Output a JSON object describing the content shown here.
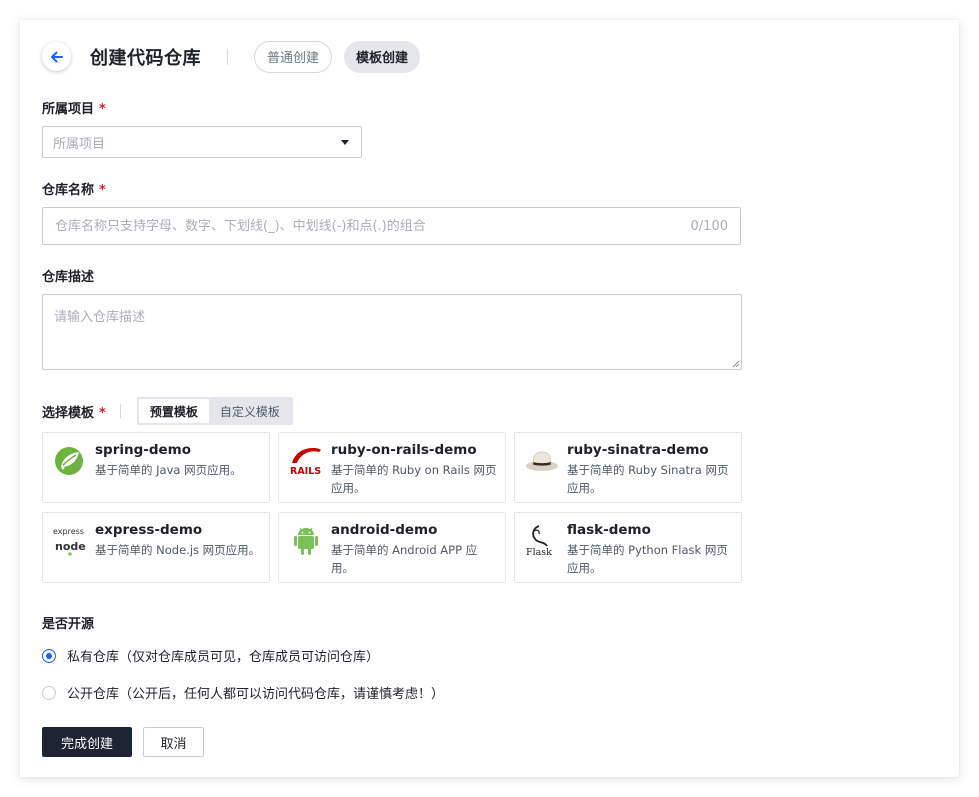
{
  "header": {
    "title": "创建代码仓库",
    "tabs": [
      {
        "label": "普通创建",
        "active": false
      },
      {
        "label": "模板创建",
        "active": true
      }
    ]
  },
  "form": {
    "project": {
      "label": "所属项目",
      "required_mark": "*",
      "placeholder": "所属项目"
    },
    "repo_name": {
      "label": "仓库名称",
      "required_mark": "*",
      "placeholder": "仓库名称只支持字母、数字、下划线(_)、中划线(-)和点(.)的组合",
      "counter": "0/100"
    },
    "description": {
      "label": "仓库描述",
      "placeholder": "请输入仓库描述"
    },
    "template": {
      "label": "选择模板",
      "required_mark": "*",
      "tabs": [
        {
          "label": "预置模板",
          "active": true
        },
        {
          "label": "自定义模板",
          "active": false
        }
      ],
      "items": [
        {
          "name": "spring-demo",
          "desc": "基于简单的 Java 网页应用。",
          "icon": "spring-icon"
        },
        {
          "name": "ruby-on-rails-demo",
          "desc": "基于简单的 Ruby on Rails 网页应用。",
          "icon": "rails-icon",
          "logo_text": "RAILS"
        },
        {
          "name": "ruby-sinatra-demo",
          "desc": "基于简单的 Ruby Sinatra 网页应用。",
          "icon": "sinatra-hat-icon"
        },
        {
          "name": "express-demo",
          "desc": "基于简单的 Node.js 网页应用。",
          "icon": "express-node-icon",
          "logo_text": "express",
          "logo_text2": "node"
        },
        {
          "name": "android-demo",
          "desc": "基于简单的 Android APP 应用。",
          "icon": "android-icon"
        },
        {
          "name": "flask-demo",
          "desc": "基于简单的 Python Flask 网页应用。",
          "icon": "flask-icon",
          "logo_text": "Flask"
        }
      ]
    },
    "visibility": {
      "label": "是否开源",
      "options": [
        {
          "label": "私有仓库（仅对仓库成员可见，仓库成员可访问仓库）",
          "checked": true
        },
        {
          "label": "公开仓库（公开后，任何人都可以访问代码仓库，请谨慎考虑！）",
          "checked": false
        }
      ]
    }
  },
  "actions": {
    "submit_label": "完成创建",
    "cancel_label": "取消"
  },
  "colors": {
    "primary": "#1e2433",
    "accent": "#1664ff",
    "required": "#e0281b"
  }
}
